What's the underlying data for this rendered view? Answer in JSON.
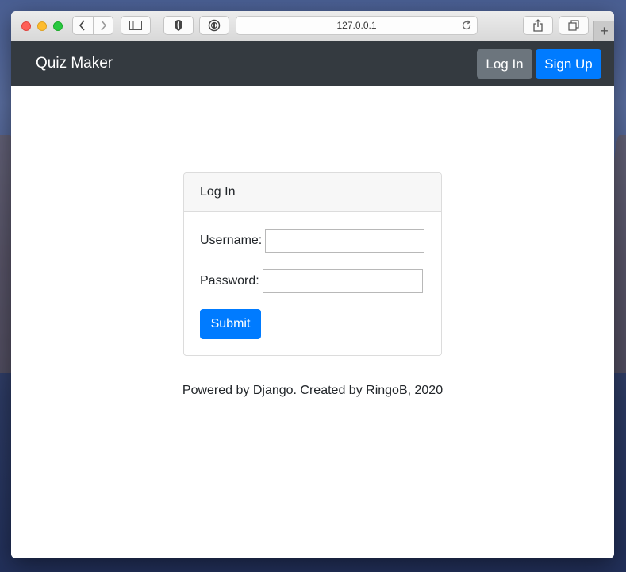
{
  "browser": {
    "url": "127.0.0.1",
    "new_tab_symbol": "+",
    "icons": [
      "back-icon",
      "forward-icon",
      "sidebar-icon",
      "privacy-shield-icon",
      "password-manager-icon",
      "reload-icon",
      "share-icon",
      "tabs-icon"
    ]
  },
  "navbar": {
    "brand": "Quiz Maker",
    "login_label": "Log In",
    "signup_label": "Sign Up"
  },
  "login_card": {
    "header": "Log In",
    "username_label": "Username:",
    "username_value": "",
    "password_label": "Password:",
    "password_value": "",
    "submit_label": "Submit"
  },
  "footer": {
    "text": "Powered by Django. Created by RingoB, 2020"
  },
  "colors": {
    "navbar_bg": "#343a40",
    "primary": "#007bff",
    "secondary": "#6c757d"
  }
}
